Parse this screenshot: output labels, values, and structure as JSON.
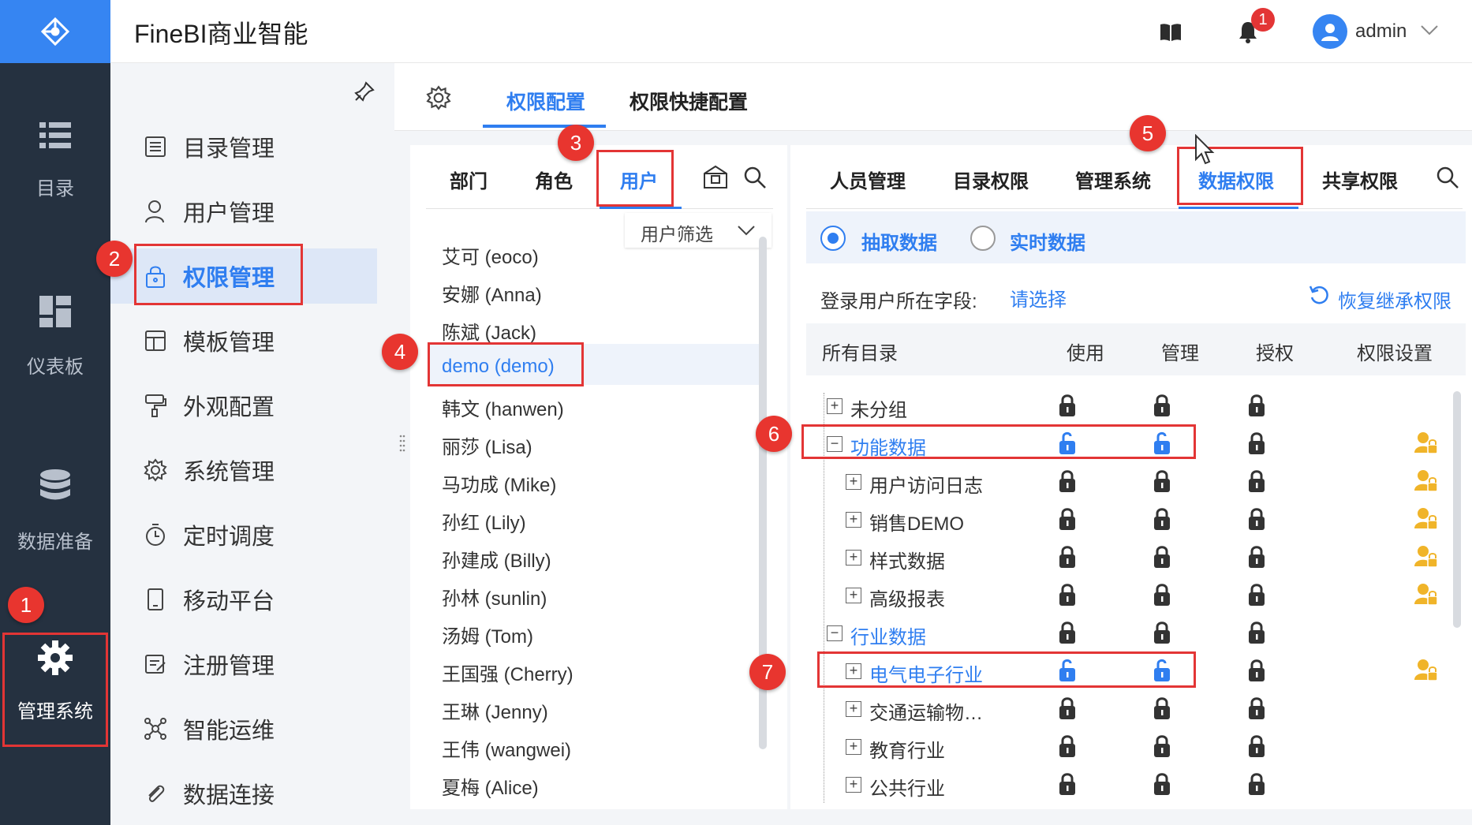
{
  "app": {
    "title": "FineBI商业智能"
  },
  "topbar": {
    "notification_count": "1",
    "user_name": "admin"
  },
  "leftnav": {
    "items": [
      {
        "label": "目录",
        "icon": "list-icon"
      },
      {
        "label": "仪表板",
        "icon": "dashboard-icon"
      },
      {
        "label": "数据准备",
        "icon": "database-icon"
      },
      {
        "label": "管理系统",
        "icon": "gear-icon"
      }
    ]
  },
  "subnav": {
    "items": [
      {
        "label": "目录管理",
        "icon": "catalog-icon"
      },
      {
        "label": "用户管理",
        "icon": "user-icon"
      },
      {
        "label": "权限管理",
        "icon": "lock-icon"
      },
      {
        "label": "模板管理",
        "icon": "template-icon"
      },
      {
        "label": "外观配置",
        "icon": "brush-icon"
      },
      {
        "label": "系统管理",
        "icon": "settings-icon"
      },
      {
        "label": "定时调度",
        "icon": "timer-icon"
      },
      {
        "label": "移动平台",
        "icon": "mobile-icon"
      },
      {
        "label": "注册管理",
        "icon": "register-icon"
      },
      {
        "label": "智能运维",
        "icon": "ops-icon"
      },
      {
        "label": "数据连接",
        "icon": "link-icon"
      }
    ]
  },
  "top_tabs": [
    "权限配置",
    "权限快捷配置"
  ],
  "left_panel": {
    "tabs": [
      "部门",
      "角色",
      "用户"
    ],
    "filter_label": "用户筛选",
    "users": [
      "艾可 (eoco)",
      "安娜 (Anna)",
      "陈斌 (Jack)",
      "demo (demo)",
      "韩文 (hanwen)",
      "丽莎 (Lisa)",
      "马功成 (Mike)",
      "孙红 (Lily)",
      "孙建成 (Billy)",
      "孙林 (sunlin)",
      "汤姆 (Tom)",
      "王国强 (Cherry)",
      "王琳 (Jenny)",
      "王伟 (wangwei)",
      "夏梅 (Alice)"
    ],
    "selected_user": "demo (demo)"
  },
  "right_panel": {
    "tabs": [
      "人员管理",
      "目录权限",
      "管理系统",
      "数据权限",
      "共享权限"
    ],
    "active_tab": "数据权限",
    "radio_options": [
      "抽取数据",
      "实时数据"
    ],
    "login_field_label": "登录用户所在字段:",
    "login_field_value": "请选择",
    "restore_label": "恢复继承权限",
    "columns": [
      "所有目录",
      "使用",
      "管理",
      "授权",
      "权限设置"
    ],
    "rows": [
      {
        "label": "未分组",
        "expander": "+",
        "indent": 0,
        "blue": false,
        "use": "locked",
        "manage": "locked",
        "grant": "locked",
        "setting": false
      },
      {
        "label": "功能数据",
        "expander": "−",
        "indent": 0,
        "blue": true,
        "use": "unlocked",
        "manage": "unlocked",
        "grant": "locked",
        "setting": true
      },
      {
        "label": "用户访问日志",
        "expander": "+",
        "indent": 1,
        "blue": false,
        "use": "locked",
        "manage": "locked",
        "grant": "locked",
        "setting": true
      },
      {
        "label": "销售DEMO",
        "expander": "+",
        "indent": 1,
        "blue": false,
        "use": "locked",
        "manage": "locked",
        "grant": "locked",
        "setting": true
      },
      {
        "label": "样式数据",
        "expander": "+",
        "indent": 1,
        "blue": false,
        "use": "locked",
        "manage": "locked",
        "grant": "locked",
        "setting": true
      },
      {
        "label": "高级报表",
        "expander": "+",
        "indent": 1,
        "blue": false,
        "use": "locked",
        "manage": "locked",
        "grant": "locked",
        "setting": true
      },
      {
        "label": "行业数据",
        "expander": "−",
        "indent": 0,
        "blue": true,
        "use": "locked",
        "manage": "locked",
        "grant": "locked",
        "setting": false
      },
      {
        "label": "电气电子行业",
        "expander": "+",
        "indent": 1,
        "blue": true,
        "use": "unlocked",
        "manage": "unlocked",
        "grant": "locked",
        "setting": true
      },
      {
        "label": "交通运输物…",
        "expander": "+",
        "indent": 1,
        "blue": false,
        "use": "locked",
        "manage": "locked",
        "grant": "locked",
        "setting": false
      },
      {
        "label": "教育行业",
        "expander": "+",
        "indent": 1,
        "blue": false,
        "use": "locked",
        "manage": "locked",
        "grant": "locked",
        "setting": false
      },
      {
        "label": "公共行业",
        "expander": "+",
        "indent": 1,
        "blue": false,
        "use": "locked",
        "manage": "locked",
        "grant": "locked",
        "setting": false
      }
    ]
  },
  "annotations": [
    "1",
    "2",
    "3",
    "4",
    "5",
    "6",
    "7"
  ],
  "colors": {
    "accent": "#2f7ef0",
    "sidebar": "#253140",
    "highlight_red": "#e33535",
    "setting_gold": "#f0b429"
  }
}
